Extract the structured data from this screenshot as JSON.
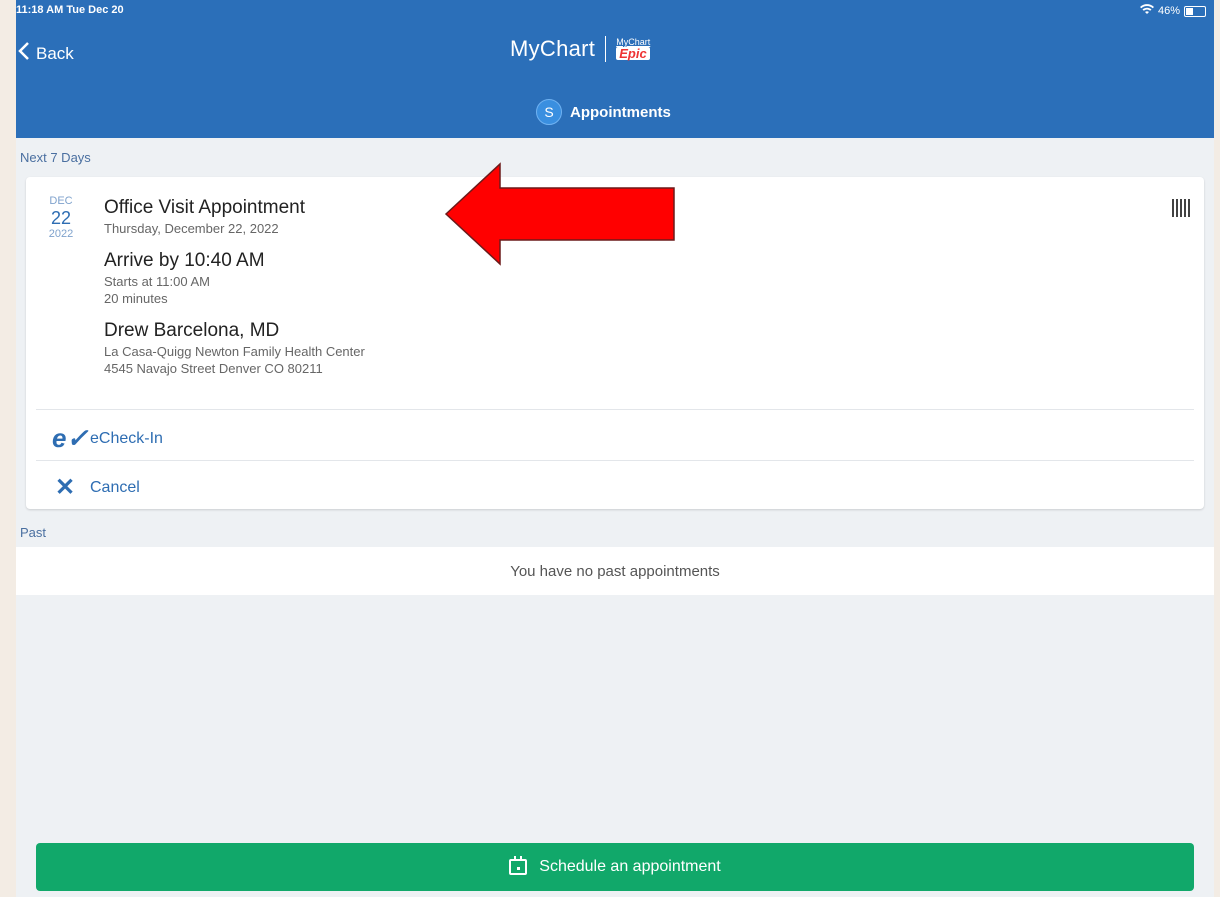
{
  "status_bar": {
    "time": "11:18 AM  Tue Dec 20",
    "battery": "46%",
    "battery_level": 0.46
  },
  "header": {
    "back_label": "Back",
    "logo_text": "MyChart",
    "logo_badge_small": "MyChart",
    "logo_badge_epic": "Epic",
    "avatar_initial": "S",
    "title": "Appointments"
  },
  "sections": {
    "upcoming_label": "Next 7 Days",
    "past_label": "Past"
  },
  "appointment": {
    "date": {
      "month": "DEC",
      "day": "22",
      "year": "2022"
    },
    "type": "Office Visit Appointment",
    "full_date": "Thursday, December 22, 2022",
    "arrive": "Arrive by 10:40 AM",
    "starts": "Starts at 11:00 AM",
    "duration": "20 minutes",
    "provider": "Drew Barcelona, MD",
    "location": "La Casa-Quigg Newton Family Health Center",
    "address": "4545 Navajo Street Denver CO 80211",
    "actions": {
      "echeckin": "eCheck-In",
      "cancel": "Cancel"
    }
  },
  "past": {
    "empty_message": "You have no past appointments"
  },
  "footer": {
    "schedule_label": "Schedule an appointment"
  },
  "colors": {
    "header": "#2b6fb9",
    "accent": "#2e6db2",
    "schedule": "#11a86a",
    "annotation_arrow": "#ff0000"
  }
}
